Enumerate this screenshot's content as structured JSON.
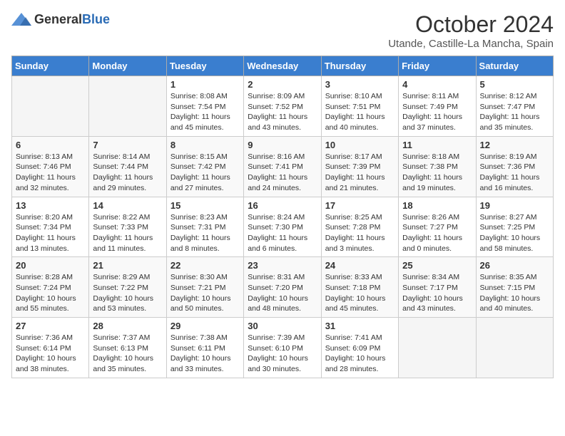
{
  "logo": {
    "general": "General",
    "blue": "Blue"
  },
  "header": {
    "month": "October 2024",
    "location": "Utande, Castille-La Mancha, Spain"
  },
  "weekdays": [
    "Sunday",
    "Monday",
    "Tuesday",
    "Wednesday",
    "Thursday",
    "Friday",
    "Saturday"
  ],
  "weeks": [
    [
      {
        "day": "",
        "info": ""
      },
      {
        "day": "",
        "info": ""
      },
      {
        "day": "1",
        "info": "Sunrise: 8:08 AM\nSunset: 7:54 PM\nDaylight: 11 hours and 45 minutes."
      },
      {
        "day": "2",
        "info": "Sunrise: 8:09 AM\nSunset: 7:52 PM\nDaylight: 11 hours and 43 minutes."
      },
      {
        "day": "3",
        "info": "Sunrise: 8:10 AM\nSunset: 7:51 PM\nDaylight: 11 hours and 40 minutes."
      },
      {
        "day": "4",
        "info": "Sunrise: 8:11 AM\nSunset: 7:49 PM\nDaylight: 11 hours and 37 minutes."
      },
      {
        "day": "5",
        "info": "Sunrise: 8:12 AM\nSunset: 7:47 PM\nDaylight: 11 hours and 35 minutes."
      }
    ],
    [
      {
        "day": "6",
        "info": "Sunrise: 8:13 AM\nSunset: 7:46 PM\nDaylight: 11 hours and 32 minutes."
      },
      {
        "day": "7",
        "info": "Sunrise: 8:14 AM\nSunset: 7:44 PM\nDaylight: 11 hours and 29 minutes."
      },
      {
        "day": "8",
        "info": "Sunrise: 8:15 AM\nSunset: 7:42 PM\nDaylight: 11 hours and 27 minutes."
      },
      {
        "day": "9",
        "info": "Sunrise: 8:16 AM\nSunset: 7:41 PM\nDaylight: 11 hours and 24 minutes."
      },
      {
        "day": "10",
        "info": "Sunrise: 8:17 AM\nSunset: 7:39 PM\nDaylight: 11 hours and 21 minutes."
      },
      {
        "day": "11",
        "info": "Sunrise: 8:18 AM\nSunset: 7:38 PM\nDaylight: 11 hours and 19 minutes."
      },
      {
        "day": "12",
        "info": "Sunrise: 8:19 AM\nSunset: 7:36 PM\nDaylight: 11 hours and 16 minutes."
      }
    ],
    [
      {
        "day": "13",
        "info": "Sunrise: 8:20 AM\nSunset: 7:34 PM\nDaylight: 11 hours and 13 minutes."
      },
      {
        "day": "14",
        "info": "Sunrise: 8:22 AM\nSunset: 7:33 PM\nDaylight: 11 hours and 11 minutes."
      },
      {
        "day": "15",
        "info": "Sunrise: 8:23 AM\nSunset: 7:31 PM\nDaylight: 11 hours and 8 minutes."
      },
      {
        "day": "16",
        "info": "Sunrise: 8:24 AM\nSunset: 7:30 PM\nDaylight: 11 hours and 6 minutes."
      },
      {
        "day": "17",
        "info": "Sunrise: 8:25 AM\nSunset: 7:28 PM\nDaylight: 11 hours and 3 minutes."
      },
      {
        "day": "18",
        "info": "Sunrise: 8:26 AM\nSunset: 7:27 PM\nDaylight: 11 hours and 0 minutes."
      },
      {
        "day": "19",
        "info": "Sunrise: 8:27 AM\nSunset: 7:25 PM\nDaylight: 10 hours and 58 minutes."
      }
    ],
    [
      {
        "day": "20",
        "info": "Sunrise: 8:28 AM\nSunset: 7:24 PM\nDaylight: 10 hours and 55 minutes."
      },
      {
        "day": "21",
        "info": "Sunrise: 8:29 AM\nSunset: 7:22 PM\nDaylight: 10 hours and 53 minutes."
      },
      {
        "day": "22",
        "info": "Sunrise: 8:30 AM\nSunset: 7:21 PM\nDaylight: 10 hours and 50 minutes."
      },
      {
        "day": "23",
        "info": "Sunrise: 8:31 AM\nSunset: 7:20 PM\nDaylight: 10 hours and 48 minutes."
      },
      {
        "day": "24",
        "info": "Sunrise: 8:33 AM\nSunset: 7:18 PM\nDaylight: 10 hours and 45 minutes."
      },
      {
        "day": "25",
        "info": "Sunrise: 8:34 AM\nSunset: 7:17 PM\nDaylight: 10 hours and 43 minutes."
      },
      {
        "day": "26",
        "info": "Sunrise: 8:35 AM\nSunset: 7:15 PM\nDaylight: 10 hours and 40 minutes."
      }
    ],
    [
      {
        "day": "27",
        "info": "Sunrise: 7:36 AM\nSunset: 6:14 PM\nDaylight: 10 hours and 38 minutes."
      },
      {
        "day": "28",
        "info": "Sunrise: 7:37 AM\nSunset: 6:13 PM\nDaylight: 10 hours and 35 minutes."
      },
      {
        "day": "29",
        "info": "Sunrise: 7:38 AM\nSunset: 6:11 PM\nDaylight: 10 hours and 33 minutes."
      },
      {
        "day": "30",
        "info": "Sunrise: 7:39 AM\nSunset: 6:10 PM\nDaylight: 10 hours and 30 minutes."
      },
      {
        "day": "31",
        "info": "Sunrise: 7:41 AM\nSunset: 6:09 PM\nDaylight: 10 hours and 28 minutes."
      },
      {
        "day": "",
        "info": ""
      },
      {
        "day": "",
        "info": ""
      }
    ]
  ]
}
